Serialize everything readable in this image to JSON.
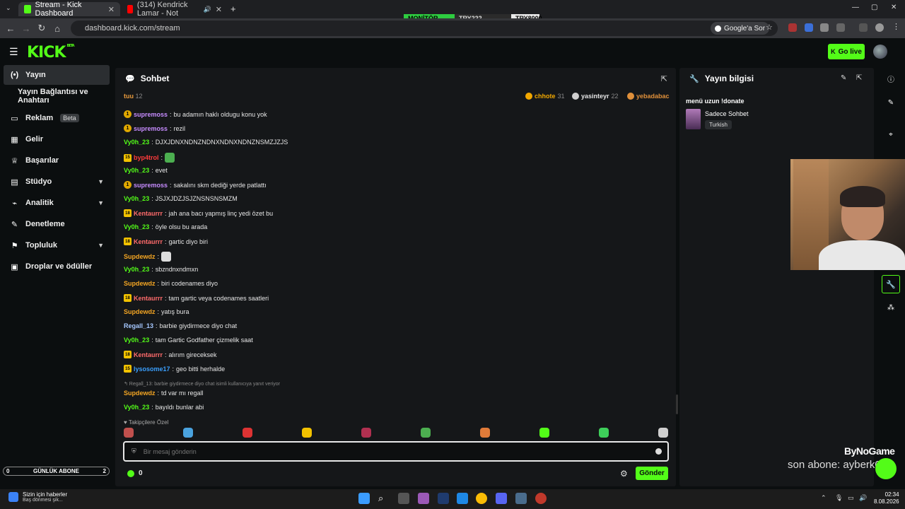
{
  "browser": {
    "tabs": [
      {
        "title": "Stream - Kick Dashboard",
        "active": true
      },
      {
        "title": "(314) Kendrick Lamar - Not",
        "active": false
      }
    ],
    "url": "dashboard.kick.com/stream",
    "google_button": "Google'a Sor",
    "ticker": {
      "label": "MONİTÖR",
      "v1": "TRY222",
      "v2": "TRY8000"
    }
  },
  "header": {
    "logo": "KICK",
    "logo_tag": "BETA",
    "go_live": "Go live"
  },
  "sidebar": {
    "items": [
      {
        "label": "Yayın",
        "icon": "broadcast-icon",
        "active": true
      },
      {
        "label": "Yayın Bağlantısı ve Anahtarı",
        "icon": "",
        "active": false
      },
      {
        "label": "Reklam",
        "icon": "monitor-icon",
        "badge": "Beta"
      },
      {
        "label": "Gelir",
        "icon": "revenue-icon"
      },
      {
        "label": "Başarılar",
        "icon": "trophy-icon"
      },
      {
        "label": "Stüdyo",
        "icon": "studio-icon",
        "expand": true
      },
      {
        "label": "Analitik",
        "icon": "analytics-icon",
        "expand": true
      },
      {
        "label": "Denetleme",
        "icon": "wrench-icon"
      },
      {
        "label": "Topluluk",
        "icon": "community-icon",
        "expand": true
      },
      {
        "label": "Droplar ve ödüller",
        "icon": "gift-icon"
      }
    ],
    "goal": {
      "left": "0",
      "label": "GÜNLÜK ABONE",
      "right": "2"
    }
  },
  "chat": {
    "title": "Sohbet",
    "top_bar": {
      "left_user": "tuu",
      "left_count": "12",
      "top_users": [
        {
          "name": "chhote",
          "count": "31",
          "color": "#f2a800"
        },
        {
          "name": "yasinteyr",
          "count": "22",
          "color": "#cfcfcf"
        },
        {
          "name": "yebadabac",
          "count": "",
          "color": "#e0903a"
        }
      ]
    },
    "messages": [
      {
        "user": "supremoss",
        "color": "#c78cff",
        "badge": "1",
        "badge_type": "one",
        "text": "bu adamın haklı oldugu konu yok"
      },
      {
        "user": "supremoss",
        "color": "#c78cff",
        "badge": "1",
        "badge_type": "one",
        "text": "rezil"
      },
      {
        "user": "Vy0h_23",
        "color": "#53fc18",
        "badge": "",
        "badge_type": "",
        "text": "DJXJDNXNDNZNDNXNDNXNDNZNSMZJZJS"
      },
      {
        "user": "byp4trol",
        "color": "#ff3b3b",
        "badge": "15",
        "badge_type": "sub",
        "text": "",
        "emote": "#4caf50"
      },
      {
        "user": "Vy0h_23",
        "color": "#53fc18",
        "badge": "",
        "badge_type": "",
        "text": "evet"
      },
      {
        "user": "supremoss",
        "color": "#c78cff",
        "badge": "1",
        "badge_type": "one",
        "text": "sakalını skm dediği yerde patlattı"
      },
      {
        "user": "Vy0h_23",
        "color": "#53fc18",
        "badge": "",
        "badge_type": "",
        "text": "JSJXJDZJSJZNSNSNSMZM"
      },
      {
        "user": "Kentaurrr",
        "color": "#ff6b6b",
        "badge": "18",
        "badge_type": "sub",
        "text": "jah ana bacı yapmış linç yedi özet bu"
      },
      {
        "user": "Vy0h_23",
        "color": "#53fc18",
        "badge": "",
        "badge_type": "",
        "text": "öyle olsu bu arada"
      },
      {
        "user": "Kentaurrr",
        "color": "#ff6b6b",
        "badge": "18",
        "badge_type": "sub",
        "text": "gartic diyo biri"
      },
      {
        "user": "Supdewdz",
        "color": "#f5a623",
        "badge": "",
        "badge_type": "",
        "text": "",
        "emote": "#dddddd"
      },
      {
        "user": "Vy0h_23",
        "color": "#53fc18",
        "badge": "",
        "badge_type": "",
        "text": "sbzndnxndmxn"
      },
      {
        "user": "Supdewdz",
        "color": "#f5a623",
        "badge": "",
        "badge_type": "",
        "text": "biri codenames diyo"
      },
      {
        "user": "Kentaurrr",
        "color": "#ff6b6b",
        "badge": "18",
        "badge_type": "sub",
        "text": "tam gartic veya codenames saatleri"
      },
      {
        "user": "Supdewdz",
        "color": "#f5a623",
        "badge": "",
        "badge_type": "",
        "text": "yatış bura"
      },
      {
        "user": "Regall_13",
        "color": "#a6c8ff",
        "badge": "",
        "badge_type": "",
        "text": "barbie giydirmece diyo chat"
      },
      {
        "user": "Vy0h_23",
        "color": "#53fc18",
        "badge": "",
        "badge_type": "",
        "text": "tam Gartic Godfather çizmelik saat"
      },
      {
        "user": "Kentaurrr",
        "color": "#ff6b6b",
        "badge": "18",
        "badge_type": "sub",
        "text": "alırım gireceksek"
      },
      {
        "user": "lysosome17",
        "color": "#3aa0ff",
        "badge": "15",
        "badge_type": "sub",
        "text": "geo bitti herhalde"
      },
      {
        "user": "Supdewdz",
        "color": "#f5a623",
        "badge": "",
        "badge_type": "",
        "text": "td var mı regall"
      },
      {
        "user": "Vy0h_23",
        "color": "#53fc18",
        "badge": "",
        "badge_type": "",
        "text": "bayıldı bunlar abi"
      }
    ],
    "reply_note": "↰ Regall_13: barbie giydirmece diyo chat isimli kullanıcıya yanıt veriyor",
    "followers_only": "♥ Takipçilere Özel",
    "emotes": [
      "#c0504d",
      "#4aa3df",
      "#d33",
      "#f2c200",
      "#b03050",
      "#4caf50",
      "#e07b39",
      "#53fc18",
      "#3ecf5a",
      "#cfcfcf"
    ],
    "input_placeholder": "Bir mesaj gönderin",
    "points": "0",
    "send": "Gönder"
  },
  "info": {
    "title": "Yayın bilgisi",
    "stream_title": "menü uzun !donate",
    "category": "Sadece Sohbet",
    "language": "Turkish"
  },
  "overlay": {
    "brand": "ByNoGame",
    "last_sub": "son abone: ayberk07"
  },
  "taskbar": {
    "news_title": "Sizin için haberler",
    "news_sub": "Baş dönmesi şik...",
    "time": "02:34",
    "date": "8.08.2026"
  }
}
